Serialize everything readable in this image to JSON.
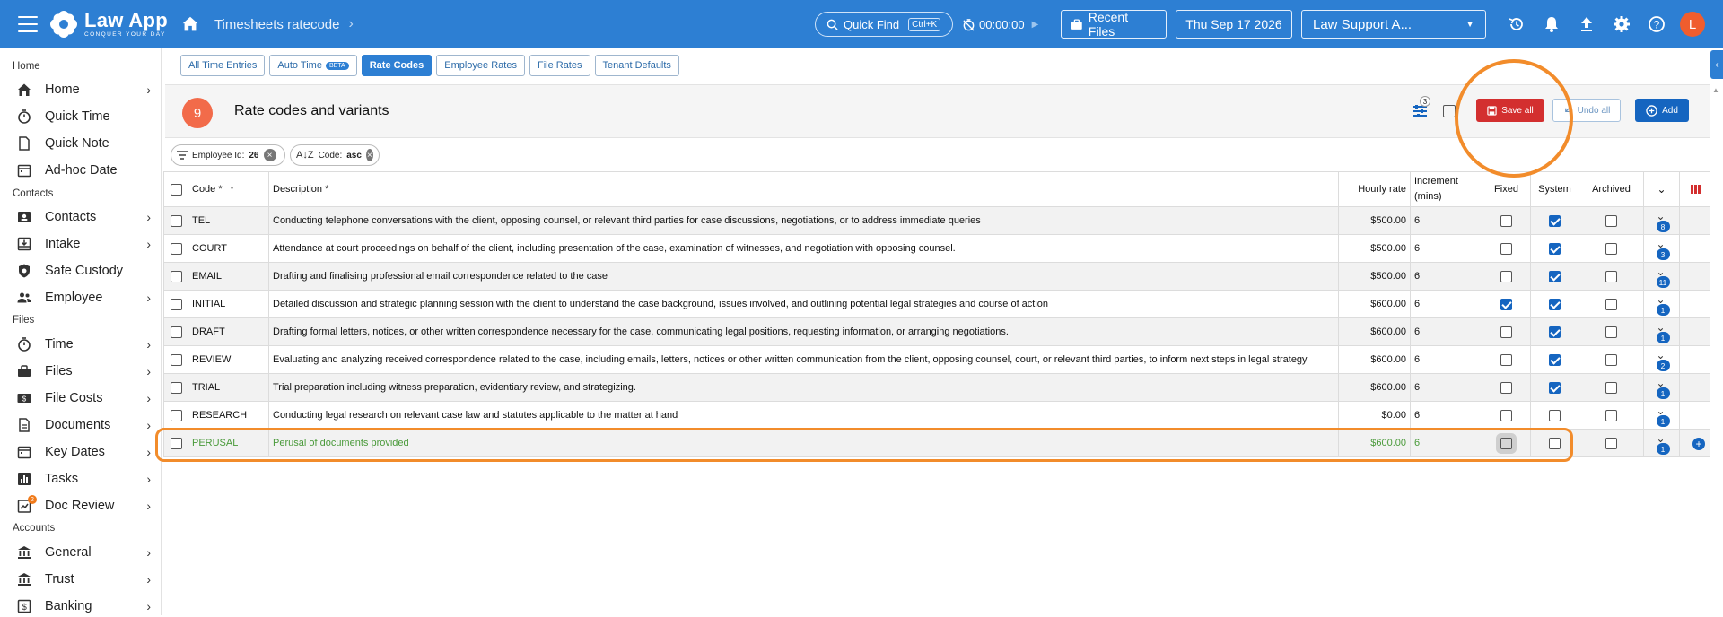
{
  "app": {
    "logo_title": "Law App",
    "logo_subtitle": "CONQUER YOUR DAY",
    "breadcrumb": "Timesheets ratecode"
  },
  "topbar": {
    "quick_find": "Quick Find",
    "quick_find_shortcut": "Ctrl+K",
    "timer": "00:00:00",
    "recent_files": "Recent Files",
    "date": "Thu Sep 17 2026",
    "tenant": "Law Support A...",
    "avatar_letter": "L"
  },
  "sidebar": {
    "sections": [
      {
        "label": "Home"
      },
      {
        "label": "Contacts"
      },
      {
        "label": "Files"
      },
      {
        "label": "Accounts"
      }
    ],
    "items": [
      {
        "label": "Home",
        "icon": "home-icon"
      },
      {
        "label": "Quick Time",
        "icon": "stopwatch-icon"
      },
      {
        "label": "Quick Note",
        "icon": "note-icon"
      },
      {
        "label": "Ad-hoc Date",
        "icon": "calendar-icon"
      },
      {
        "label": "Contacts",
        "icon": "contact-card-icon"
      },
      {
        "label": "Intake",
        "icon": "inbox-icon"
      },
      {
        "label": "Safe Custody",
        "icon": "safe-icon"
      },
      {
        "label": "Employee",
        "icon": "people-icon"
      },
      {
        "label": "Time",
        "icon": "stopwatch-icon"
      },
      {
        "label": "Files",
        "icon": "briefcase-icon"
      },
      {
        "label": "File Costs",
        "icon": "money-icon"
      },
      {
        "label": "Documents",
        "icon": "document-icon"
      },
      {
        "label": "Key Dates",
        "icon": "calendar-icon"
      },
      {
        "label": "Tasks",
        "icon": "chart-icon"
      },
      {
        "label": "Doc Review",
        "icon": "review-icon",
        "badge": "2"
      },
      {
        "label": "General",
        "icon": "bank-icon"
      },
      {
        "label": "Trust",
        "icon": "bank-icon"
      },
      {
        "label": "Banking",
        "icon": "dollar-icon"
      }
    ]
  },
  "tabs": [
    {
      "label": "All Time Entries"
    },
    {
      "label": "Auto Time",
      "badge": "BETA"
    },
    {
      "label": "Rate Codes"
    },
    {
      "label": "Employee Rates"
    },
    {
      "label": "File Rates"
    },
    {
      "label": "Tenant Defaults"
    }
  ],
  "panel": {
    "count": "9",
    "title": "Rate codes and variants",
    "filter_badge": "3",
    "save_all": "Save all",
    "undo_all": "Undo all",
    "add": "Add"
  },
  "chips": [
    {
      "label": "Employee Id:",
      "value": "26"
    },
    {
      "label": "Code:",
      "value": "asc"
    }
  ],
  "table": {
    "headers": {
      "code": "Code *",
      "description": "Description *",
      "hourly_rate": "Hourly rate",
      "increment": "Increment (mins)",
      "fixed": "Fixed",
      "system": "System",
      "archived": "Archived"
    },
    "rows": [
      {
        "code": "TEL",
        "description": "Conducting telephone conversations with the client, opposing counsel, or relevant third parties for case discussions, negotiations, or to address immediate queries",
        "rate": "$500.00",
        "increment": "6",
        "fixed": false,
        "system": true,
        "archived": false,
        "count": "8"
      },
      {
        "code": "COURT",
        "description": "Attendance at court proceedings on behalf of the client, including presentation of the case, examination of witnesses, and negotiation with opposing counsel.",
        "rate": "$500.00",
        "increment": "6",
        "fixed": false,
        "system": true,
        "archived": false,
        "count": "3"
      },
      {
        "code": "EMAIL",
        "description": "Drafting and finalising professional email correspondence related to the case",
        "rate": "$500.00",
        "increment": "6",
        "fixed": false,
        "system": true,
        "archived": false,
        "count": "11"
      },
      {
        "code": "INITIAL",
        "description": "Detailed discussion and strategic planning session with the client to understand the case background, issues involved, and outlining potential legal strategies and course of action",
        "rate": "$600.00",
        "increment": "6",
        "fixed": true,
        "system": true,
        "archived": false,
        "count": "1"
      },
      {
        "code": "DRAFT",
        "description": "Drafting formal letters, notices, or other written correspondence necessary for the case, communicating legal positions, requesting information, or arranging negotiations.",
        "rate": "$600.00",
        "increment": "6",
        "fixed": false,
        "system": true,
        "archived": false,
        "count": "1"
      },
      {
        "code": "REVIEW",
        "description": "Evaluating and analyzing received correspondence related to the case, including emails, letters, notices or other written communication from the client, opposing counsel, court, or relevant third parties, to inform next steps in legal strategy",
        "rate": "$600.00",
        "increment": "6",
        "fixed": false,
        "system": true,
        "archived": false,
        "count": "2"
      },
      {
        "code": "TRIAL",
        "description": "Trial preparation including witness preparation, evidentiary review, and strategizing.",
        "rate": "$600.00",
        "increment": "6",
        "fixed": false,
        "system": true,
        "archived": false,
        "count": "1"
      },
      {
        "code": "RESEARCH",
        "description": "Conducting legal research on relevant case law and statutes applicable to the matter at hand",
        "rate": "$0.00",
        "increment": "6",
        "fixed": false,
        "system": false,
        "archived": false,
        "count": "1"
      },
      {
        "code": "PERUSAL",
        "description": "Perusal of documents provided",
        "rate": "$600.00",
        "increment": "6",
        "fixed": false,
        "system": false,
        "archived": false,
        "count": "1"
      }
    ]
  },
  "colors": {
    "primary": "#2d7fd3",
    "danger": "#d32f2f",
    "highlight": "#f28c2b",
    "new_row_text": "#4a9a3a"
  }
}
